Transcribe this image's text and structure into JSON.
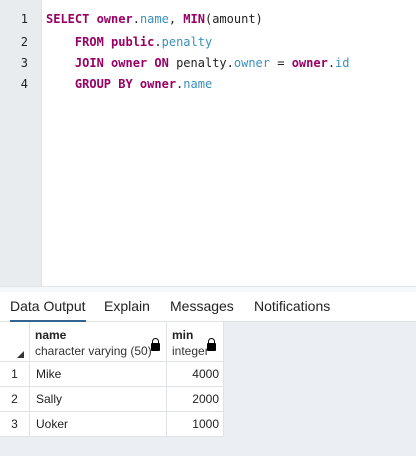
{
  "editor": {
    "line_numbers": [
      "1",
      "2",
      "3",
      "4"
    ],
    "lines": [
      [
        {
          "t": "SELECT ",
          "c": "kw"
        },
        {
          "t": "owner",
          "c": "kw"
        },
        {
          "t": ".",
          "c": ""
        },
        {
          "t": "name",
          "c": "id"
        },
        {
          "t": ", ",
          "c": ""
        },
        {
          "t": "MIN",
          "c": "fn"
        },
        {
          "t": "(amount)",
          "c": ""
        }
      ],
      [
        {
          "t": "    FROM ",
          "c": "kw"
        },
        {
          "t": "public",
          "c": "kw"
        },
        {
          "t": ".",
          "c": ""
        },
        {
          "t": "penalty",
          "c": "id"
        }
      ],
      [
        {
          "t": "    JOIN ",
          "c": "kw"
        },
        {
          "t": "owner ",
          "c": "kw"
        },
        {
          "t": "ON ",
          "c": "kw"
        },
        {
          "t": "penalty.",
          "c": ""
        },
        {
          "t": "owner",
          "c": "id"
        },
        {
          "t": " = ",
          "c": ""
        },
        {
          "t": "owner",
          "c": "kw"
        },
        {
          "t": ".",
          "c": ""
        },
        {
          "t": "id",
          "c": "id"
        }
      ],
      [
        {
          "t": "    GROUP BY ",
          "c": "kw"
        },
        {
          "t": "owner",
          "c": "kw"
        },
        {
          "t": ".",
          "c": ""
        },
        {
          "t": "name",
          "c": "id"
        }
      ]
    ]
  },
  "tabs": [
    "Data Output",
    "Explain",
    "Messages",
    "Notifications"
  ],
  "active_tab": "Data Output",
  "grid": {
    "columns": [
      {
        "name": "name",
        "type": "character varying (50)"
      },
      {
        "name": "min",
        "type": "integer"
      }
    ],
    "rows": [
      {
        "n": "1",
        "name": "Mike",
        "min": "4000"
      },
      {
        "n": "2",
        "name": "Sally",
        "min": "2000"
      },
      {
        "n": "3",
        "name": "Uoker",
        "min": "1000"
      }
    ]
  },
  "colors": {
    "keyword": "#990066",
    "identifier": "#3a8fbf",
    "tab_active": "#326690"
  }
}
